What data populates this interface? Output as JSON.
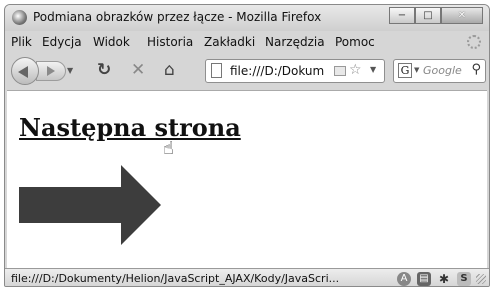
{
  "window": {
    "title": "Podmiana obrazków przez łącze - Mozilla Firefox",
    "controls": {
      "minimize": "−",
      "maximize": "□",
      "close": "✕"
    }
  },
  "menu": [
    {
      "id": "plik",
      "label": "Plik"
    },
    {
      "id": "edycja",
      "label": "Edycja"
    },
    {
      "id": "widok",
      "label": "Widok"
    },
    {
      "id": "historia",
      "label": "Historia"
    },
    {
      "id": "zakladki",
      "label": "Zakładki"
    },
    {
      "id": "narzedzia",
      "label": "Narzędzia"
    },
    {
      "id": "pomoc",
      "label": "Pomoc"
    }
  ],
  "toolbar": {
    "url": "file:///D:/Dokum",
    "search_placeholder": "Google",
    "search_engine_glyph": "G"
  },
  "page": {
    "link_text": "Następna strona"
  },
  "status": {
    "text": "file:///D:/Dokumenty/Helion/JavaScript_AJAX/Kody/JavaScri..."
  },
  "icons": [
    "back-icon",
    "forward-icon",
    "reload-icon",
    "stop-icon",
    "home-icon",
    "page-icon",
    "rss-icon",
    "bookmark-star-icon",
    "google-icon",
    "search-icon",
    "hand-cursor-icon",
    "adblock-icon",
    "extension-icon",
    "gesture-icon",
    "s-addon-icon"
  ],
  "colors": {
    "arrow": "#3d3d3d",
    "link": "#111111"
  }
}
